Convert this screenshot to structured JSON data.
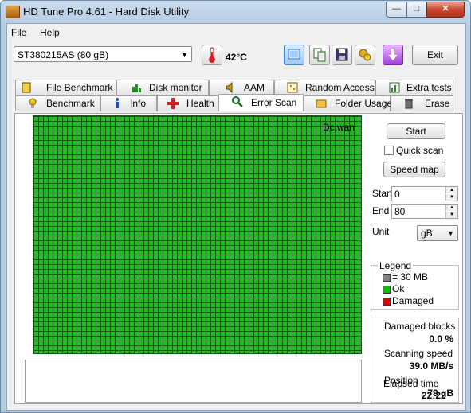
{
  "window": {
    "title": "HD Tune Pro 4.61 - Hard Disk Utility"
  },
  "menu": {
    "file": "File",
    "help": "Help"
  },
  "toolbar": {
    "drive": "ST380215AS (80 gB)",
    "temperature": "42°C",
    "exit_label": "Exit"
  },
  "tabs_row1": [
    "File Benchmark",
    "Disk monitor",
    "AAM",
    "Random Access",
    "Extra tests"
  ],
  "tabs_row2": [
    "Benchmark",
    "Info",
    "Health",
    "Error Scan",
    "Folder Usage",
    "Erase"
  ],
  "active_tab": "Error Scan",
  "scan": {
    "overlay_text": "Dc.wan"
  },
  "controls": {
    "start_button": "Start",
    "quick_scan_label": "Quick scan",
    "quick_scan_checked": false,
    "speed_map_button": "Speed map",
    "start_label": "Start",
    "start_value": "0",
    "end_label": "End",
    "end_value": "80",
    "unit_label": "Unit",
    "unit_value": "gB"
  },
  "legend": {
    "title": "Legend",
    "block_size": "= 30 MB",
    "ok": "Ok",
    "damaged": "Damaged",
    "colors": {
      "block": "#808080",
      "ok": "#00c000",
      "damaged": "#e00000"
    }
  },
  "stats": {
    "damaged_label": "Damaged blocks",
    "damaged_value": "0.0 %",
    "speed_label": "Scanning speed",
    "speed_value": "39.0 MB/s",
    "position_label": "Position",
    "position_value": "79 gB",
    "elapsed_label": "Elapsed time",
    "elapsed_value": "22:22"
  }
}
